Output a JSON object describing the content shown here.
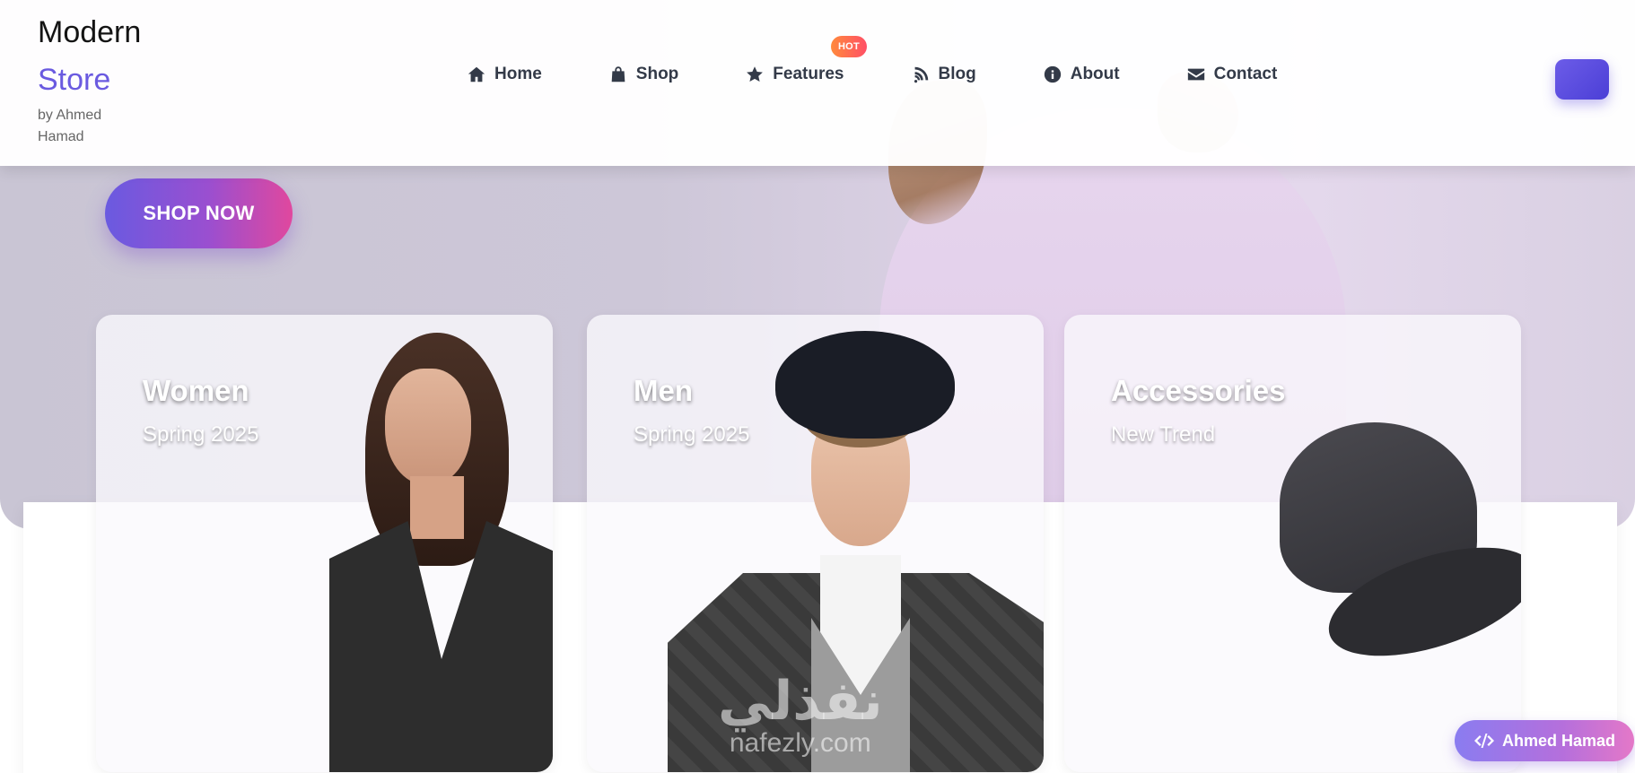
{
  "logo": {
    "line1": "Modern",
    "line2": "Store",
    "byline": "by Ahmed Hamad"
  },
  "nav": {
    "items": [
      {
        "label": "Home",
        "icon": "home-icon"
      },
      {
        "label": "Shop",
        "icon": "shopping-bag-icon"
      },
      {
        "label": "Features",
        "icon": "star-icon"
      },
      {
        "label": "Blog",
        "icon": "rss-icon"
      },
      {
        "label": "About",
        "icon": "info-icon"
      },
      {
        "label": "Contact",
        "icon": "envelope-icon"
      }
    ],
    "hot_badge": "HOT"
  },
  "hero": {
    "cta_label": "SHOP NOW"
  },
  "categories": [
    {
      "title": "Women",
      "subtitle": "Spring 2025"
    },
    {
      "title": "Men",
      "subtitle": "Spring 2025"
    },
    {
      "title": "Accessories",
      "subtitle": "New Trend"
    }
  ],
  "watermark": {
    "arabic": "نفذلي",
    "latin": "nafezly.com"
  },
  "author_badge": {
    "label": "Ahmed Hamad",
    "icon": "code-icon"
  },
  "colors": {
    "brand": "#6a5ae0",
    "accent_pink": "#e0489e",
    "nav_text": "#333a48",
    "hot": "#ff5c5c"
  }
}
